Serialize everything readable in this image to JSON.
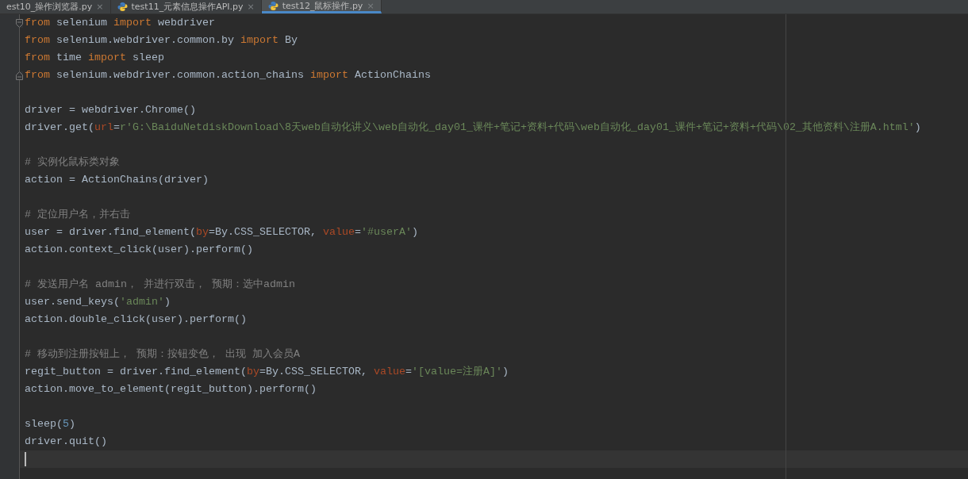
{
  "tabs": [
    {
      "label": "est10_操作浏览器.py",
      "selected": false,
      "python": false,
      "close": "×"
    },
    {
      "label": "test11_元素信息操作API.py",
      "selected": false,
      "python": true,
      "close": "×"
    },
    {
      "label": "test12_鼠标操作.py",
      "selected": true,
      "python": true,
      "close": "×"
    }
  ],
  "lines": [
    {
      "kind": "code",
      "fold_start": true,
      "tokens": [
        {
          "kind": "kw",
          "text": "from"
        },
        {
          "kind": "plain",
          "text": " selenium "
        },
        {
          "kind": "kw",
          "text": "import"
        },
        {
          "kind": "plain",
          "text": " webdriver"
        }
      ]
    },
    {
      "kind": "code",
      "tokens": [
        {
          "kind": "kw",
          "text": "from"
        },
        {
          "kind": "plain",
          "text": " selenium.webdriver.common.by "
        },
        {
          "kind": "kw",
          "text": "import"
        },
        {
          "kind": "plain",
          "text": " By"
        }
      ]
    },
    {
      "kind": "code",
      "tokens": [
        {
          "kind": "kw",
          "text": "from"
        },
        {
          "kind": "plain",
          "text": " time "
        },
        {
          "kind": "kw",
          "text": "import"
        },
        {
          "kind": "plain",
          "text": " sleep"
        }
      ]
    },
    {
      "kind": "code",
      "fold_end": true,
      "tokens": [
        {
          "kind": "kw",
          "text": "from"
        },
        {
          "kind": "plain",
          "text": " selenium.webdriver.common.action_chains "
        },
        {
          "kind": "kw",
          "text": "import"
        },
        {
          "kind": "plain",
          "text": " ActionChains"
        }
      ]
    },
    {
      "kind": "blank"
    },
    {
      "kind": "code",
      "tokens": [
        {
          "kind": "plain",
          "text": "driver = webdriver.Chrome()"
        }
      ]
    },
    {
      "kind": "code",
      "tokens": [
        {
          "kind": "plain",
          "text": "driver.get("
        },
        {
          "kind": "param",
          "text": "url"
        },
        {
          "kind": "plain",
          "text": "="
        },
        {
          "kind": "str",
          "text": "r'G:\\BaiduNetdiskDownload\\8天web自动化讲义\\web自动化_day01_课件+笔记+资料+代码\\web自动化_day01_课件+笔记+资料+代码\\02_其他资料\\注册A.html'"
        },
        {
          "kind": "plain",
          "text": ")"
        }
      ]
    },
    {
      "kind": "blank"
    },
    {
      "kind": "code",
      "tokens": [
        {
          "kind": "comment",
          "text": "# 实例化鼠标类对象"
        }
      ]
    },
    {
      "kind": "code",
      "tokens": [
        {
          "kind": "plain",
          "text": "action = ActionChains(driver)"
        }
      ]
    },
    {
      "kind": "blank"
    },
    {
      "kind": "code",
      "tokens": [
        {
          "kind": "comment",
          "text": "# 定位用户名，并右击"
        }
      ]
    },
    {
      "kind": "code",
      "tokens": [
        {
          "kind": "plain",
          "text": "user = driver.find_element("
        },
        {
          "kind": "param",
          "text": "by"
        },
        {
          "kind": "plain",
          "text": "=By.CSS_SELECTOR, "
        },
        {
          "kind": "param",
          "text": "value"
        },
        {
          "kind": "plain",
          "text": "="
        },
        {
          "kind": "str",
          "text": "'#userA'"
        },
        {
          "kind": "plain",
          "text": ")"
        }
      ]
    },
    {
      "kind": "code",
      "tokens": [
        {
          "kind": "plain",
          "text": "action.context_click(user).perform()"
        }
      ]
    },
    {
      "kind": "blank"
    },
    {
      "kind": "code",
      "tokens": [
        {
          "kind": "comment",
          "text": "# 发送用户名 admin， 并进行双击， 预期：选中admin"
        }
      ]
    },
    {
      "kind": "code",
      "tokens": [
        {
          "kind": "plain",
          "text": "user.send_keys("
        },
        {
          "kind": "str",
          "text": "'admin'"
        },
        {
          "kind": "plain",
          "text": ")"
        }
      ]
    },
    {
      "kind": "code",
      "tokens": [
        {
          "kind": "plain",
          "text": "action.double_click(user).perform()"
        }
      ]
    },
    {
      "kind": "blank"
    },
    {
      "kind": "code",
      "tokens": [
        {
          "kind": "comment",
          "text": "# 移动到注册按钮上， 预期：按钮变色， 出现 加入会员A"
        }
      ]
    },
    {
      "kind": "code",
      "tokens": [
        {
          "kind": "plain",
          "text": "regit_button = driver.find_element("
        },
        {
          "kind": "param",
          "text": "by"
        },
        {
          "kind": "plain",
          "text": "=By.CSS_SELECTOR, "
        },
        {
          "kind": "param",
          "text": "value"
        },
        {
          "kind": "plain",
          "text": "="
        },
        {
          "kind": "str",
          "text": "'[value=注册A]'"
        },
        {
          "kind": "plain",
          "text": ")"
        }
      ]
    },
    {
      "kind": "code",
      "tokens": [
        {
          "kind": "plain",
          "text": "action.move_to_element(regit_button).perform()"
        }
      ]
    },
    {
      "kind": "blank"
    },
    {
      "kind": "code",
      "tokens": [
        {
          "kind": "plain",
          "text": "sleep("
        },
        {
          "kind": "num",
          "text": "5"
        },
        {
          "kind": "plain",
          "text": ")"
        }
      ]
    },
    {
      "kind": "code",
      "tokens": [
        {
          "kind": "plain",
          "text": "driver.quit()"
        }
      ]
    },
    {
      "kind": "cursor"
    }
  ]
}
